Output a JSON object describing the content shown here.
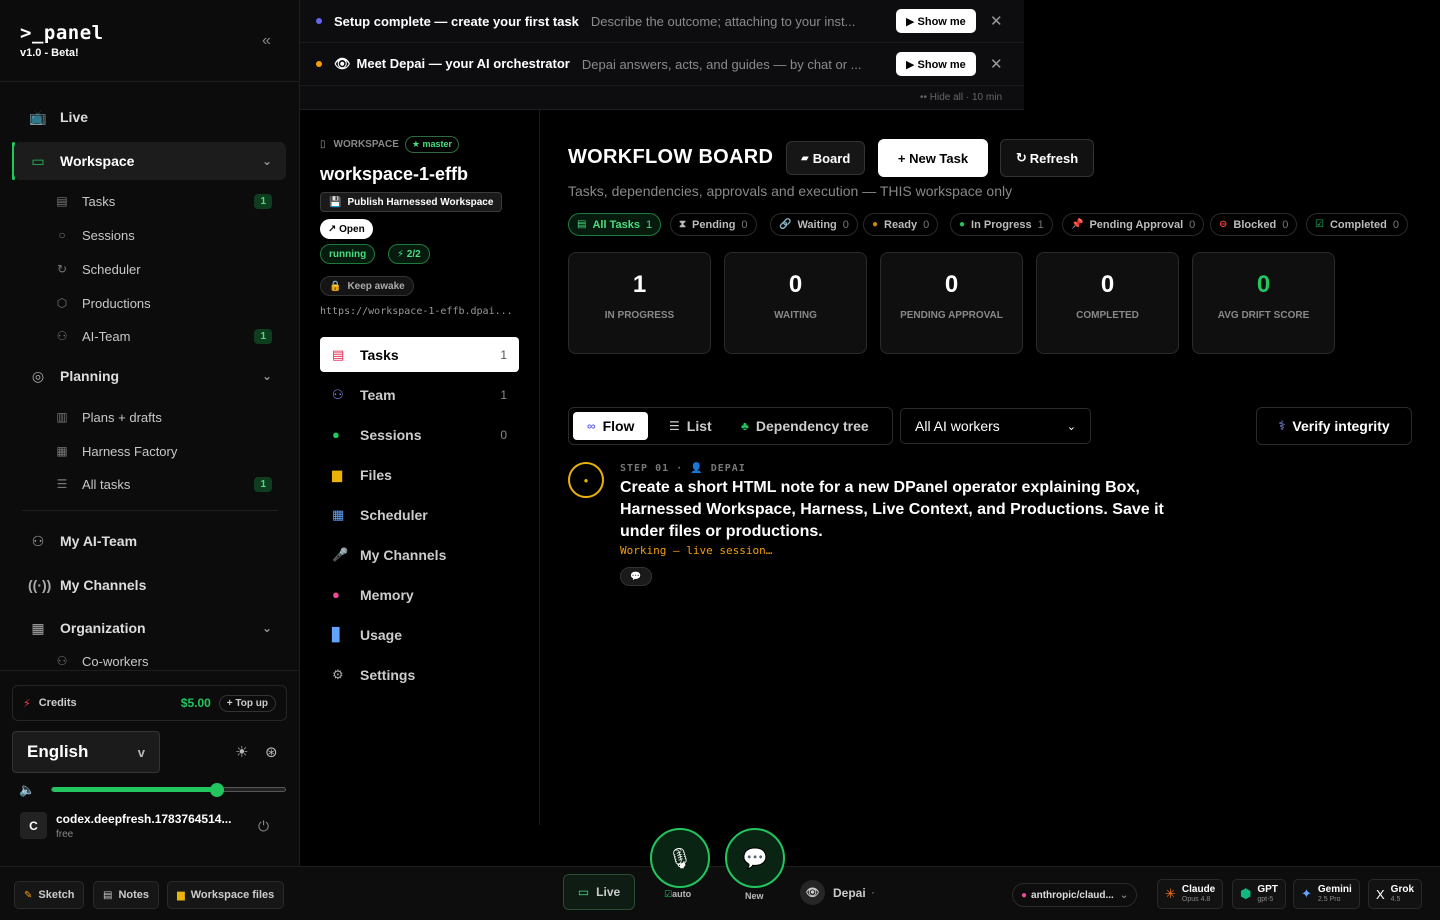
{
  "brand": {
    "title": ">_panel",
    "version": "v1.0 - Beta!"
  },
  "sidebar": {
    "live": "Live",
    "workspace": "Workspace",
    "workspace_items": [
      {
        "label": "Tasks",
        "badge": "1"
      },
      {
        "label": "Sessions",
        "badge": ""
      },
      {
        "label": "Scheduler",
        "badge": ""
      },
      {
        "label": "Productions",
        "badge": ""
      },
      {
        "label": "AI-Team",
        "badge": "1"
      }
    ],
    "planning": "Planning",
    "planning_items": [
      {
        "label": "Plans + drafts",
        "badge": ""
      },
      {
        "label": "Harness Factory",
        "badge": ""
      },
      {
        "label": "All tasks",
        "badge": "1"
      }
    ],
    "my_ai_team": "My AI-Team",
    "my_channels": "My Channels",
    "organization": "Organization",
    "coworkers": "Co-workers",
    "credits_label": "Credits",
    "credits_amount": "$5.00",
    "topup": "+ Top up",
    "language": "English",
    "language_chevron": "v",
    "volume_level": 0.7,
    "user_initial": "C",
    "user_name": "codex.deepfresh.1783764514...",
    "user_plan": "free"
  },
  "banner": {
    "rows": [
      {
        "title": "Setup complete — create your first task",
        "desc": "Describe the outcome; attaching to your inst...",
        "button": "▶ Show me",
        "dot_color": "#6366f1"
      },
      {
        "title": "Meet Depai — your AI orchestrator",
        "desc": "Depai answers, acts, and guides — by chat or ...",
        "button": "▶ Show me",
        "dot_color": "#f59e0b"
      }
    ],
    "hide_all": "•• Hide all · 10 min"
  },
  "workspace": {
    "label": "WORKSPACE",
    "branch": "★ master",
    "name": "workspace-1-effb",
    "publish": "Publish Harnessed Workspace",
    "open": "↗ Open",
    "status": "running",
    "agents": "⚡ 2/2",
    "keep_awake": "Keep awake",
    "url": "https://workspace-1-effb.dpai...",
    "nav": [
      {
        "label": "Tasks",
        "count": "1"
      },
      {
        "label": "Team",
        "count": "1"
      },
      {
        "label": "Sessions",
        "count": "0"
      },
      {
        "label": "Files",
        "count": ""
      },
      {
        "label": "Scheduler",
        "count": ""
      },
      {
        "label": "My Channels",
        "count": ""
      },
      {
        "label": "Memory",
        "count": ""
      },
      {
        "label": "Usage",
        "count": ""
      }
    ],
    "settings": "Settings"
  },
  "board": {
    "title": "WORKFLOW BOARD",
    "board_btn": "Board",
    "new_task_btn": "+ New Task",
    "refresh_btn": "Refresh",
    "subtitle": "Tasks, dependencies, approvals and execution — THIS workspace only",
    "filters": [
      {
        "label": "All Tasks",
        "count": "1"
      },
      {
        "label": "Pending",
        "count": "0"
      },
      {
        "label": "Waiting",
        "count": "0"
      },
      {
        "label": "Ready",
        "count": "0"
      },
      {
        "label": "In Progress",
        "count": "1"
      },
      {
        "label": "Pending Approval",
        "count": "0"
      },
      {
        "label": "Blocked",
        "count": "0"
      },
      {
        "label": "Completed",
        "count": "0"
      }
    ],
    "stats": [
      {
        "value": "1",
        "label": "IN PROGRESS"
      },
      {
        "value": "0",
        "label": "WAITING"
      },
      {
        "value": "0",
        "label": "PENDING APPROVAL"
      },
      {
        "value": "0",
        "label": "COMPLETED"
      },
      {
        "value": "0",
        "label": "AVG DRIFT SCORE"
      }
    ],
    "views": {
      "flow": "Flow",
      "list": "List",
      "tree": "Dependency tree"
    },
    "worker_select": "All AI workers",
    "verify": "Verify integrity",
    "step": {
      "label": "STEP 01",
      "owner": "DEPAI",
      "title": "Create a short HTML note for a new DPanel operator explaining Box, Harnessed Workspace, Harness, Live Context, and Productions. Save it under files or productions.",
      "status": "Working — live session…"
    }
  },
  "bottombar": {
    "sketch": "Sketch",
    "notes": "Notes",
    "workspace_files": "Workspace files",
    "live": "Live",
    "auto": "auto",
    "new": "New",
    "depai": "Depai",
    "model": "anthropic/claud...",
    "providers": [
      {
        "name": "Claude",
        "sub": "Opus 4.8",
        "color": "#f97316"
      },
      {
        "name": "GPT",
        "sub": "gpt-5",
        "color": "#10b981"
      },
      {
        "name": "Gemini",
        "sub": "2.5 Pro",
        "color": "#60a5fa"
      },
      {
        "name": "Grok",
        "sub": "4.5",
        "color": "#ffffff"
      }
    ]
  }
}
